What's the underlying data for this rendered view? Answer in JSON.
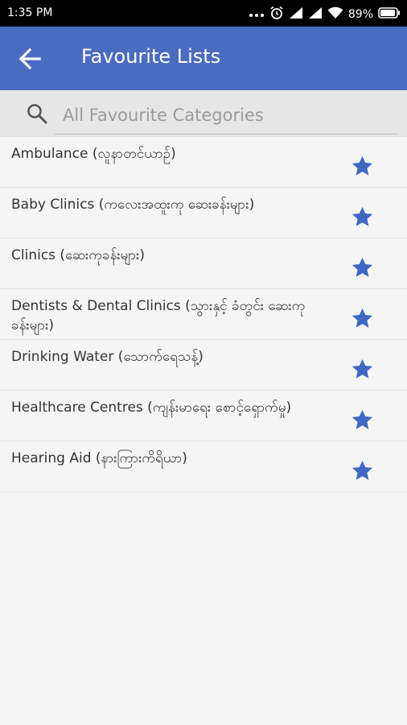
{
  "status_bar": {
    "time": "1:35 PM",
    "battery_percent": "89%",
    "icons": [
      "dots-icon",
      "alarm-icon",
      "signal-icon",
      "signal-icon",
      "wifi-icon",
      "battery-icon"
    ]
  },
  "app_bar": {
    "back_icon": "arrow-left-icon",
    "title": "Favourite Lists",
    "color": "#4a6cc0"
  },
  "search": {
    "icon": "search-icon",
    "placeholder": "All Favourite Categories"
  },
  "accent_color": "#3f68c4",
  "items": [
    {
      "label": "Ambulance (လူနာတင်ယာဉ်)",
      "favorited": true
    },
    {
      "label": "Baby Clinics (ကလေးအထူးကု ဆေးခန်းများ)",
      "favorited": true
    },
    {
      "label": "Clinics (ဆေးကုခန်းများ)",
      "favorited": true
    },
    {
      "label": "Dentists & Dental Clinics (သွားနှင့် ခံတွင်း ဆေးကုခန်းများ)",
      "favorited": true
    },
    {
      "label": "Drinking Water (သောက်ရေသန့်)",
      "favorited": true
    },
    {
      "label": "Healthcare Centres (ကျန်းမာရေး စောင့်ရှောက်မှု)",
      "favorited": true
    },
    {
      "label": "Hearing Aid (နားကြားကိရိယာ)",
      "favorited": true
    }
  ]
}
